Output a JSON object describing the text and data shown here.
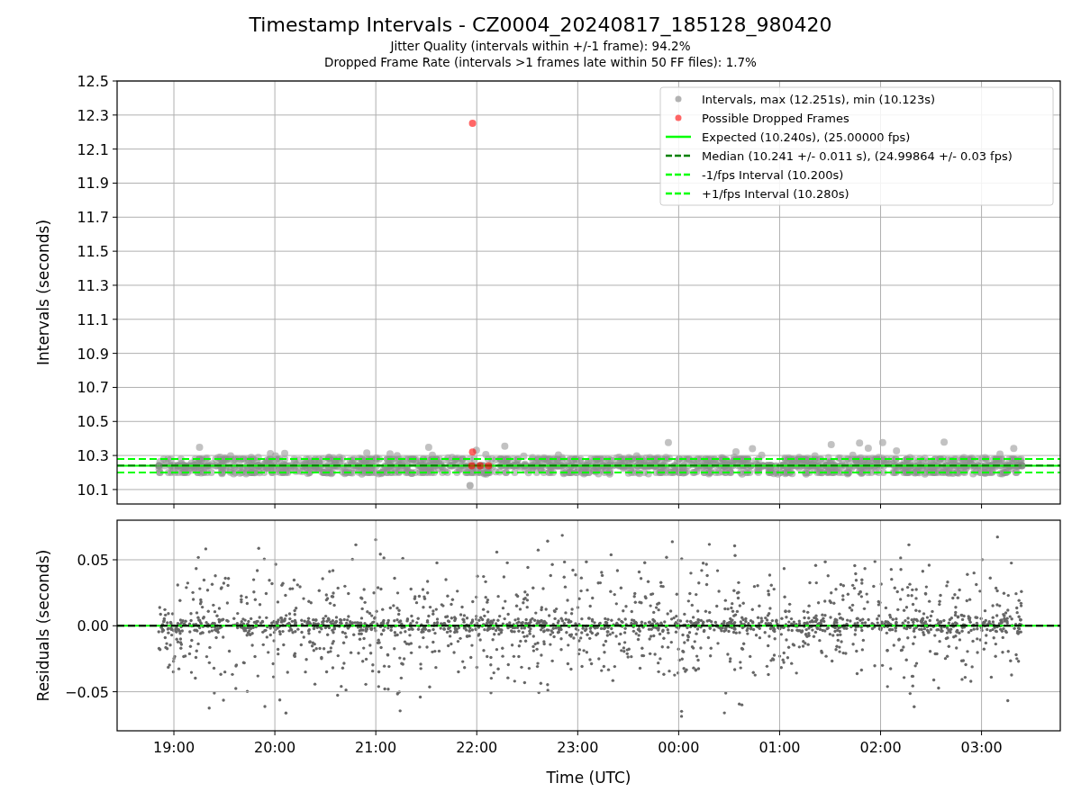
{
  "title": "Timestamp Intervals - CZ0004_20240817_185128_980420",
  "subtitles": [
    "Jitter Quality (intervals within +/-1 frame): 94.2%",
    "Dropped Frame Rate (intervals >1 frames late within 50 FF files): 1.7%"
  ],
  "intervals_chart": {
    "chart_data": {
      "type": "scatter",
      "ylabel": "Intervals (seconds)",
      "grid": true,
      "xlim": [
        "2024-08-17T18:26:15",
        "2024-08-18T03:46:48"
      ],
      "ylim": [
        10.015,
        12.5
      ],
      "yticks": [
        {
          "value": 10.1,
          "label": "10.1"
        },
        {
          "value": 10.3,
          "label": "10.3"
        },
        {
          "value": 10.5,
          "label": "10.5"
        },
        {
          "value": 10.7,
          "label": "10.7"
        },
        {
          "value": 10.9,
          "label": "10.9"
        },
        {
          "value": 11.1,
          "label": "11.1"
        },
        {
          "value": 11.3,
          "label": "11.3"
        },
        {
          "value": 11.5,
          "label": "11.5"
        },
        {
          "value": 11.7,
          "label": "11.7"
        },
        {
          "value": 11.9,
          "label": "11.9"
        },
        {
          "value": 12.1,
          "label": "12.1"
        },
        {
          "value": 12.3,
          "label": "12.3"
        },
        {
          "value": 12.5,
          "label": "12.5"
        }
      ],
      "series": [
        {
          "name": "Intervals, max (12.251s), min (10.123s)",
          "color": "#808080",
          "x": [
            "2024-08-17T18:51:00",
            "2024-08-18T03:24:00",
            "2024-08-17T21:56:00"
          ],
          "values": [
            10.24,
            10.24,
            10.123
          ]
        },
        {
          "name": "Possible Dropped Frames",
          "color": "#ff0000",
          "x": [
            "2024-08-17T21:57:00",
            "2024-08-17T22:02:00",
            "2024-08-17T22:07:00",
            "2024-08-17T21:57:30",
            "2024-08-17T21:57:30"
          ],
          "values": [
            10.24,
            10.24,
            10.24,
            12.251,
            10.32
          ]
        }
      ],
      "ref_lines": [
        {
          "axis": "y",
          "value": 10.24,
          "label": "Expected (10.240s), (25.00000 fps)",
          "color": "#00ff00"
        },
        {
          "axis": "y",
          "value": 10.241,
          "label": "Median (10.241 +/- 0.011 s), (24.99864 +/- 0.03 fps)",
          "color": "#008000"
        },
        {
          "axis": "y",
          "value": 10.2,
          "label": "-1/fps Interval (10.200s)",
          "color": "#00ff00"
        },
        {
          "axis": "y",
          "value": 10.28,
          "label": "+1/fps Interval (10.280s)",
          "color": "#00ff00"
        }
      ],
      "legend": "upper right"
    }
  },
  "residuals_chart": {
    "chart_data": {
      "type": "scatter",
      "xlabel": "Time (UTC)",
      "ylabel": "Residuals (seconds)",
      "grid": true,
      "xlim": [
        "2024-08-17T18:26:15",
        "2024-08-18T03:46:48"
      ],
      "ylim": [
        -0.0796,
        0.08
      ],
      "yticks": [
        {
          "value": -0.05,
          "label": "−0.05"
        },
        {
          "value": 0,
          "label": "0.00"
        },
        {
          "value": 0.05,
          "label": "0.05"
        }
      ],
      "xticks": [
        {
          "value": "2024-08-17T19:00:00",
          "label": "19:00"
        },
        {
          "value": "2024-08-17T20:00:00",
          "label": "20:00"
        },
        {
          "value": "2024-08-17T21:00:00",
          "label": "21:00"
        },
        {
          "value": "2024-08-17T22:00:00",
          "label": "22:00"
        },
        {
          "value": "2024-08-17T23:00:00",
          "label": "23:00"
        },
        {
          "value": "2024-08-18T00:00:00",
          "label": "00:00"
        },
        {
          "value": "2024-08-18T01:00:00",
          "label": "01:00"
        },
        {
          "value": "2024-08-18T02:00:00",
          "label": "02:00"
        },
        {
          "value": "2024-08-18T03:00:00",
          "label": "03:00"
        }
      ],
      "ref_lines": [
        {
          "axis": "y",
          "value": 0,
          "color": "#00ff00"
        },
        {
          "axis": "y",
          "value": 0,
          "color": "#000000"
        }
      ]
    }
  }
}
